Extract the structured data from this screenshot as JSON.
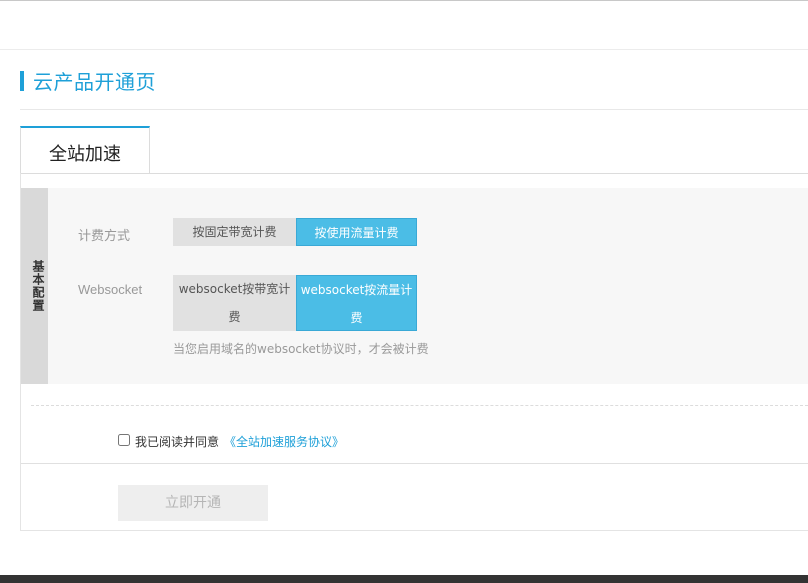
{
  "page": {
    "title": "云产品开通页"
  },
  "tabs": [
    {
      "label": "全站加速",
      "active": true
    }
  ],
  "config": {
    "section_label": "基本配置",
    "billing": {
      "label": "计费方式",
      "options": [
        {
          "label": "按固定带宽计费",
          "selected": false
        },
        {
          "label": "按使用流量计费",
          "selected": true
        }
      ]
    },
    "websocket": {
      "label": "Websocket",
      "options": [
        {
          "label": "websocket按带宽计费",
          "selected": false
        },
        {
          "label": "websocket按流量计费",
          "selected": true
        }
      ],
      "hint": "当您启用域名的websocket协议时，才会被计费"
    }
  },
  "agreement": {
    "checked": false,
    "text": "我已阅读并同意",
    "link": "《全站加速服务协议》"
  },
  "submit": {
    "label": "立即开通",
    "disabled": true
  },
  "colors": {
    "accent": "#1ea0d8",
    "selected_option": "#4bbde6",
    "unselected_option": "#e1e1e1",
    "disabled_button": "#eeeeee",
    "footer": "#333333"
  }
}
